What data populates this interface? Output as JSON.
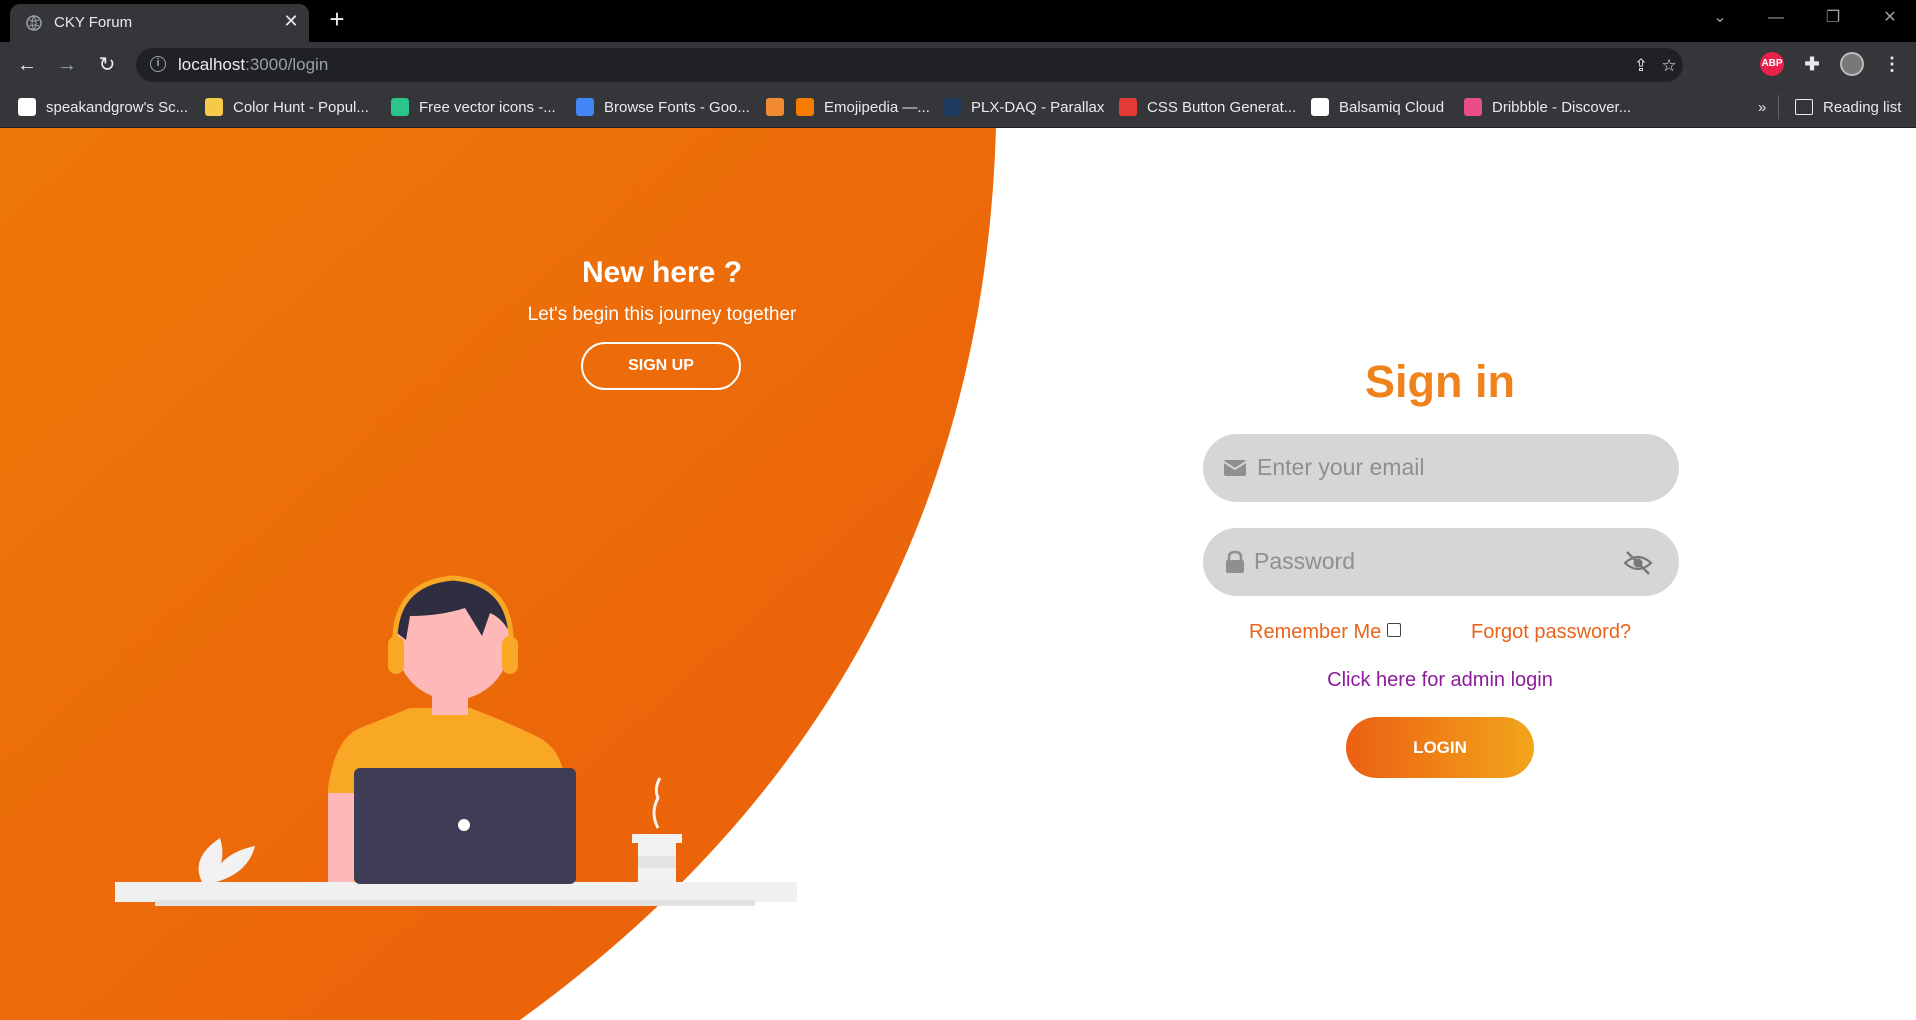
{
  "browser": {
    "tab_title": "CKY Forum",
    "tab_close": "✕",
    "new_tab": "+",
    "url_host": "localhost",
    "url_path": ":3000/login",
    "bookmarks": [
      {
        "label": "speakandgrow's Sc...",
        "color": "#ffffff"
      },
      {
        "label": "Color Hunt - Popul...",
        "color": "#f7c948"
      },
      {
        "label": "Free vector icons -...",
        "color": "#2bc48a"
      },
      {
        "label": "Browse Fonts - Goo...",
        "color": "#4285f4"
      },
      {
        "label": "",
        "color": "#f28b30"
      },
      {
        "label": "Emojipedia —...",
        "color": "#f57c00"
      },
      {
        "label": "PLX-DAQ - Parallax",
        "color": "#1e3a5f"
      },
      {
        "label": "CSS Button Generat...",
        "color": "#e53935"
      },
      {
        "label": "Balsamiq Cloud",
        "color": "#ffffff"
      },
      {
        "label": "Dribbble - Discover...",
        "color": "#ea4c89"
      }
    ],
    "more_bookmarks": "»",
    "reading_list": "Reading list",
    "abp_label": "ABP"
  },
  "promo": {
    "title": "New here ?",
    "subtitle": "Let's begin this journey together",
    "signup_label": "SIGN UP"
  },
  "signin": {
    "title": "Sign in",
    "email_placeholder": "Enter your email",
    "password_placeholder": "Password",
    "remember_label": "Remember Me",
    "forgot_label": "Forgot password?",
    "admin_label": "Click here for admin login",
    "login_label": "LOGIN"
  },
  "colors": {
    "accent_orange": "#ec6a0c",
    "title_orange": "#f0821c",
    "admin_purple": "#8b1c9a",
    "field_bg": "#d6d6d6"
  }
}
